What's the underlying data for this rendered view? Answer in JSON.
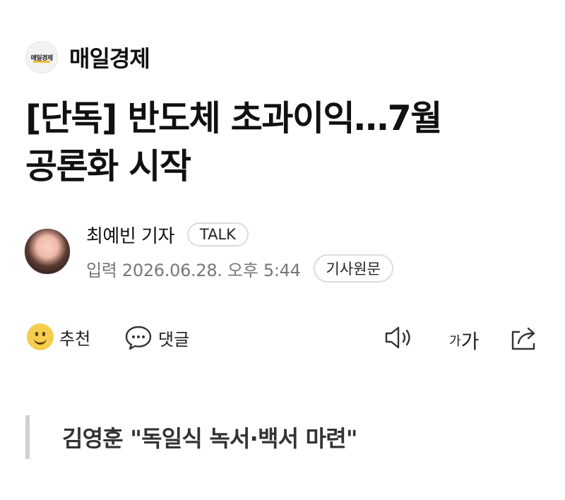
{
  "press": {
    "logo_text": "매일경제",
    "name": "매일경제"
  },
  "article": {
    "headline_line1": "[단독] 반도체 초과이익…7월",
    "headline_line2": "공론화 시작",
    "subheadline": "김영훈 \"독일식 녹서·백서 마련\""
  },
  "reporter": {
    "name": "최예빈 기자",
    "talk_label": "TALK",
    "input_date": "입력 2026.06.28. 오후 5:44",
    "original_label": "기사원문"
  },
  "actions": {
    "recommend_label": "추천",
    "comment_label": "댓글",
    "font_small": "가",
    "font_large": "가"
  },
  "colors": {
    "accent": "#f2c230",
    "smile": "#f6cd4f",
    "quote_bar": "#cfcfcf"
  }
}
